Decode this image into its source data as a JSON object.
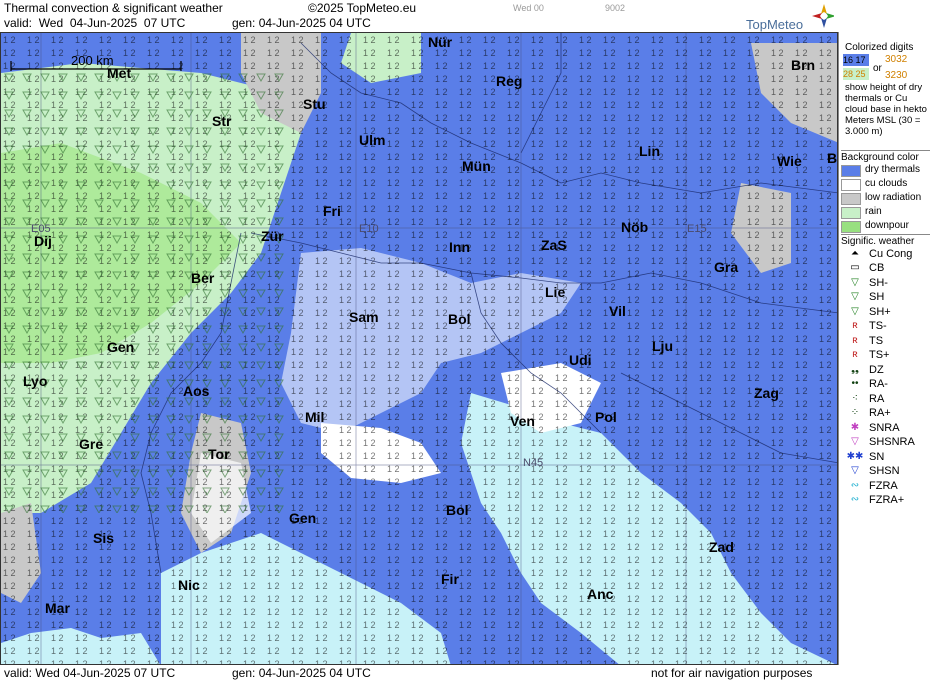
{
  "header": {
    "title": "Thermal convection & significant weather",
    "copyright": "©2025 TopMeteo.eu",
    "valid_label": "valid:",
    "valid_day": "Wed",
    "valid_date": "04-Jun-2025",
    "valid_time": "07 UTC",
    "gen_label": "gen: 04-Jun-2025 04 UTC",
    "wed00": "Wed 00",
    "code": "9002",
    "logo": "TopMeteo"
  },
  "footer": {
    "valid": "valid:  Wed  04-Jun-2025  07 UTC",
    "gen": "gen: 04-Jun-2025 04 UTC",
    "note": "not for air navigation purposes"
  },
  "map": {
    "scale": "200 km",
    "grid_labels": [
      "E05",
      "E10",
      "E15",
      "N45"
    ],
    "cities": [
      {
        "name": "Nür"
      },
      {
        "name": "Brn"
      },
      {
        "name": "Reg"
      },
      {
        "name": "Met"
      },
      {
        "name": "Stu"
      },
      {
        "name": "Str"
      },
      {
        "name": "Ulm"
      },
      {
        "name": "Lin"
      },
      {
        "name": "Wie"
      },
      {
        "name": "B"
      },
      {
        "name": "Mün"
      },
      {
        "name": "Fri"
      },
      {
        "name": "Inn"
      },
      {
        "name": "ZaS"
      },
      {
        "name": "Nöb"
      },
      {
        "name": "Zür"
      },
      {
        "name": "Dij"
      },
      {
        "name": "Gra"
      },
      {
        "name": "Ber"
      },
      {
        "name": "Lie"
      },
      {
        "name": "Vil"
      },
      {
        "name": "Sam"
      },
      {
        "name": "Bol"
      },
      {
        "name": "Lju"
      },
      {
        "name": "Gen"
      },
      {
        "name": "Udi"
      },
      {
        "name": "Lyo"
      },
      {
        "name": "Aos"
      },
      {
        "name": "Zag"
      },
      {
        "name": "Mil"
      },
      {
        "name": "Ven"
      },
      {
        "name": "Pol"
      },
      {
        "name": "Gre"
      },
      {
        "name": "Tor"
      },
      {
        "name": "Gen"
      },
      {
        "name": "Bol"
      },
      {
        "name": "Sis"
      },
      {
        "name": "Zad"
      },
      {
        "name": "Nic"
      },
      {
        "name": "Fir"
      },
      {
        "name": "Mar"
      },
      {
        "name": "Anc"
      }
    ]
  },
  "legend": {
    "colorized_title": "Colorized digits",
    "box1_a": "16",
    "box1_b": "17",
    "box2_a": "28",
    "box2_b": "25",
    "or": "or",
    "num1": "3032",
    "num2": "3230",
    "desc": "show height of dry thermals or Cu cloud base in hekto Meters MSL (30 = 3.000 m)",
    "bg_title": "Background color",
    "bg_items": [
      {
        "label": "dry thermals",
        "color": "#5a7ee8"
      },
      {
        "label": "cu clouds",
        "color": "#ffffff"
      },
      {
        "label": "low radiation",
        "color": "#c8c8c8"
      },
      {
        "label": "rain",
        "color": "#c8f0c8"
      },
      {
        "label": "downpour",
        "color": "#98e080"
      }
    ],
    "sw_title": "Signific. weather",
    "wx_items": [
      {
        "sym": "⏶",
        "label": "Cu Cong"
      },
      {
        "sym": "▭",
        "label": "CB"
      },
      {
        "sym": "▽",
        "label": "SH-"
      },
      {
        "sym": "▽",
        "label": "SH"
      },
      {
        "sym": "▽",
        "label": "SH+"
      },
      {
        "sym": "ʀ",
        "label": "TS-"
      },
      {
        "sym": "ʀ",
        "label": "TS"
      },
      {
        "sym": "ʀ",
        "label": "TS+"
      },
      {
        "sym": "❟❟",
        "label": "DZ"
      },
      {
        "sym": "••",
        "label": "RA-"
      },
      {
        "sym": "⁖",
        "label": "RA"
      },
      {
        "sym": "⁘",
        "label": "RA+"
      },
      {
        "sym": "✱",
        "label": "SNRA"
      },
      {
        "sym": "▽",
        "label": "SHSNRA"
      },
      {
        "sym": "✱✱",
        "label": "SN"
      },
      {
        "sym": "▽",
        "label": "SHSN"
      },
      {
        "sym": "∾",
        "label": "FZRA"
      },
      {
        "sym": "∾",
        "label": "FZRA+"
      }
    ]
  }
}
